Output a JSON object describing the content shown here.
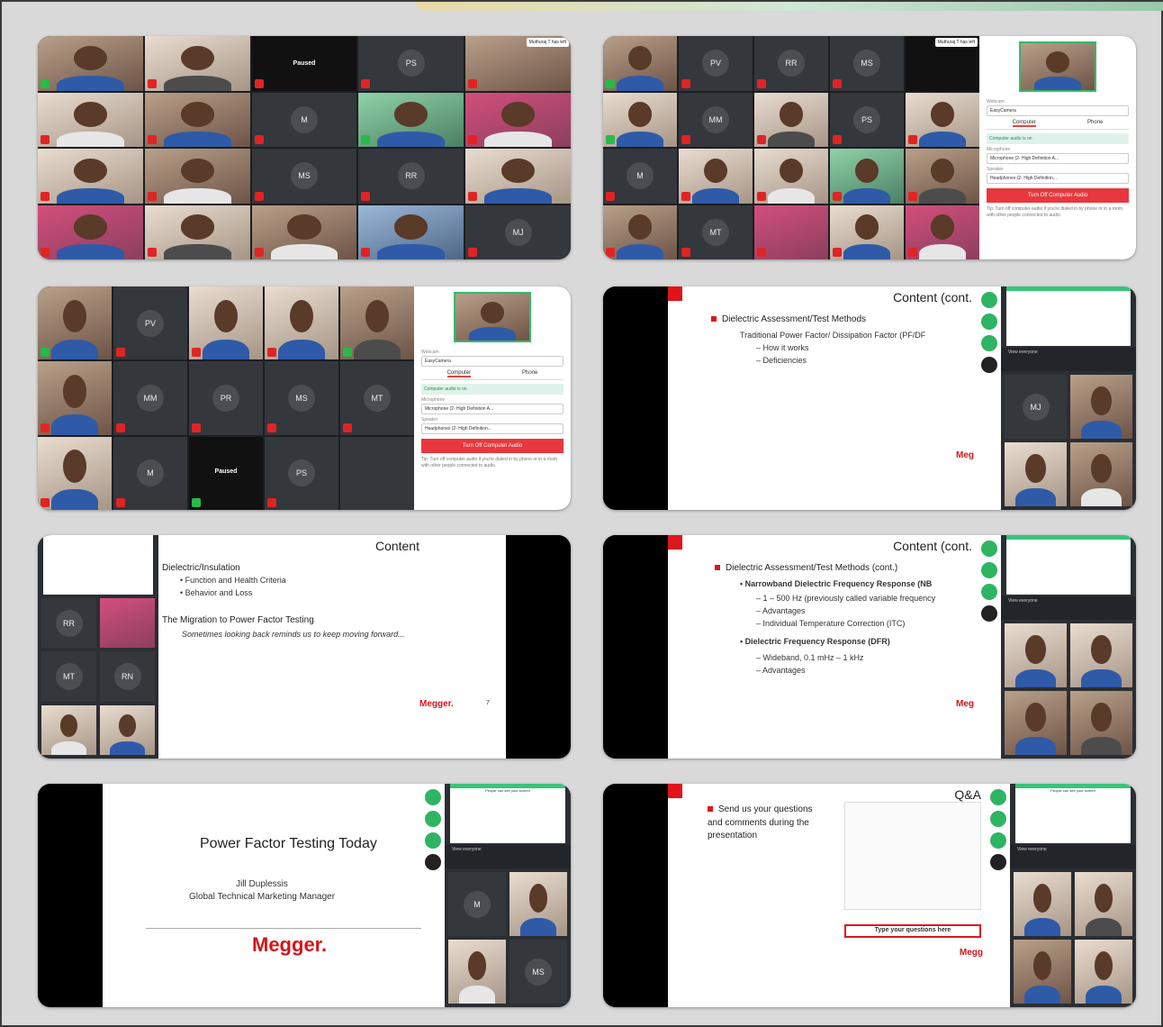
{
  "screens": {
    "s1": {
      "name_chip": "Muthuraj T has left",
      "paused": "Paused",
      "avatars": [
        "PS",
        "M",
        "MS",
        "RR",
        "MJ"
      ]
    },
    "s2": {
      "name_chip": "Muthuraj T has left",
      "avatars": [
        "PV",
        "RR",
        "MS",
        "MM",
        "PS",
        "M",
        "MT"
      ],
      "panel": {
        "camera_label": "Webcam",
        "camera_value": "EasyCamera",
        "tab_computer": "Computer",
        "tab_phone": "Phone",
        "audio_on": "Computer audio is on",
        "mic_label": "Microphone",
        "mic_value": "Microphone (2- High Definition A...",
        "speaker_label": "Speaker",
        "speaker_value": "Headphones (2- High Definition...",
        "button": "Turn Off Computer Audio",
        "tip": "Tip: Turn off computer audio if you're dialed in by phone or in a room with other people connected to audio."
      }
    },
    "s3": {
      "avatars": [
        "PV",
        "MM",
        "PR",
        "MS",
        "MT",
        "M",
        "PS"
      ],
      "paused": "Paused",
      "panel": {
        "camera_label": "Webcam",
        "camera_value": "EasyCamera",
        "tab_computer": "Computer",
        "tab_phone": "Phone",
        "audio_on": "Computer audio is on",
        "mic_label": "Microphone",
        "mic_value": "Microphone (2- High Definition A...",
        "speaker_label": "Speaker",
        "speaker_value": "Headphones (2- High Definition...",
        "button": "Turn Off Computer Audio",
        "tip": "Tip: Turn off computer audio if you're dialed in by phone or in a room with other people connected to audio."
      }
    },
    "s4": {
      "title": "Content (cont.",
      "bullet": "Dielectric Assessment/Test Methods",
      "sub1": "Traditional Power Factor/ Dissipation Factor (PF/DF",
      "sub2": "– How it works",
      "sub3": "– Deficiencies",
      "logo": "Meg",
      "panel_head": "View everyone",
      "avatar": "MJ"
    },
    "s5": {
      "title": "Content",
      "line1": "Dielectric/Insulation",
      "line2": "Function and Health Criteria",
      "line3": "Behavior and Loss",
      "line4": "The Migration to Power Factor Testing",
      "line5": "Sometimes looking back reminds us to keep moving forward...",
      "logo": "Megger.",
      "page": "7",
      "avatars": [
        "RR",
        "MT",
        "RN"
      ]
    },
    "s6": {
      "title": "Content (cont.",
      "bullet": "Dielectric Assessment/Test Methods (cont.)",
      "nb": "Narrowband Dielectric Frequency Response (NB",
      "nb1": "– 1 – 500 Hz  (previously called variable frequency",
      "nb2": "– Advantages",
      "nb3": "– Individual Temperature Correction (ITC)",
      "dfr": "Dielectric Frequency Response (DFR)",
      "dfr1": "– Wideband, 0.1 mHz – 1 kHz",
      "dfr2": "– Advantages",
      "logo": "Meg",
      "panel_head": "View everyone"
    },
    "s7": {
      "title": "Power Factor Testing Today",
      "name": "Jill Duplessis",
      "role": "Global Technical Marketing Manager",
      "logo": "Megger.",
      "share": "People can see your screen",
      "panel_head": "View everyone",
      "avatars": [
        "M",
        "MS"
      ]
    },
    "s8": {
      "title": "Q&A",
      "text": "Send us your questions and comments during the presentation",
      "qbox": "Type your questions here",
      "logo": "Megg",
      "share": "People can see your screen",
      "panel_head": "View everyone"
    }
  }
}
